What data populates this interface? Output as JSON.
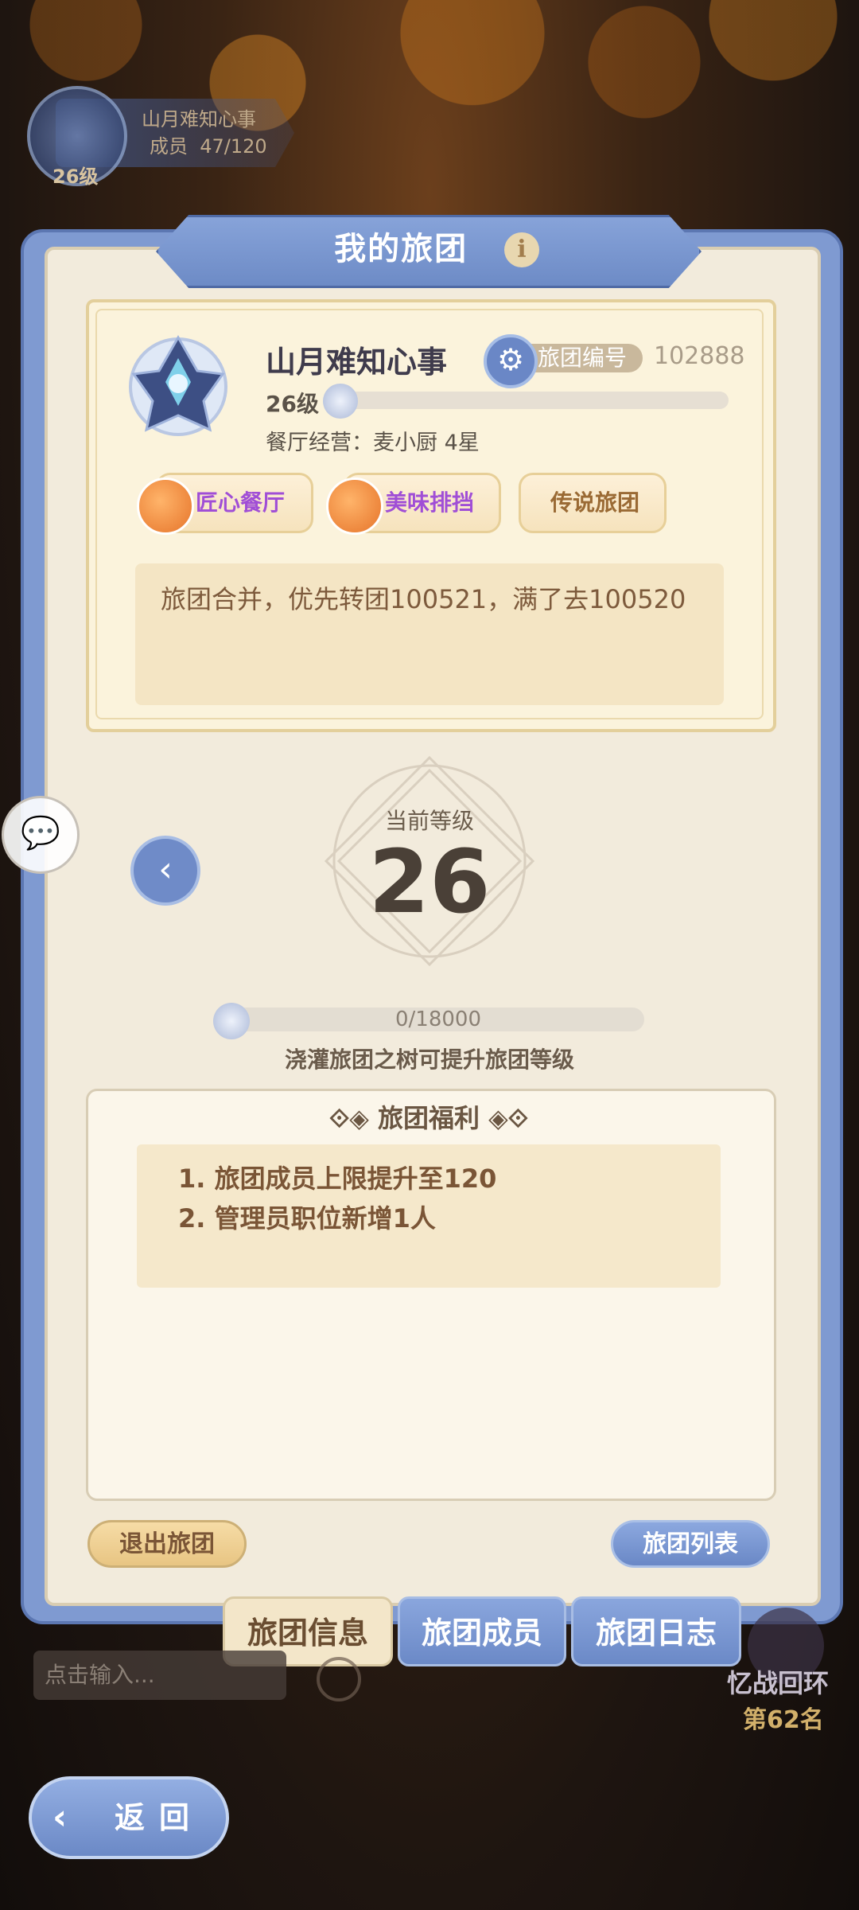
{
  "hud": {
    "guild_name": "山月难知心事",
    "members_label": "成员",
    "members_value": "47/120",
    "level": "26级"
  },
  "panel": {
    "title": "我的旅团",
    "info_icon": "i"
  },
  "guild": {
    "name": "山月难知心事",
    "id_label": "旅团编号",
    "id_value": "102888",
    "level": "26级",
    "level_progress": 0.0,
    "restaurant": "餐厅经营：麦小厨  4星",
    "tags": [
      "匠心餐厅",
      "美味排挡",
      "传说旅团"
    ],
    "notice": "旅团合并，优先转团100521，满了去100520"
  },
  "level_panel": {
    "label": "当前等级",
    "value": "26",
    "exp_text": "0/18000",
    "exp_progress": 0.0,
    "hint": "浇灌旅团之树可提升旅团等级"
  },
  "benefits": {
    "title": "旅团福利",
    "items": [
      "1.  旅团成员上限提升至120",
      "2.  管理员职位新增1人"
    ]
  },
  "actions": {
    "quit": "退出旅团",
    "list": "旅团列表"
  },
  "tabs": [
    {
      "label": "旅团信息",
      "active": true
    },
    {
      "label": "旅团成员",
      "active": false
    },
    {
      "label": "旅团日志",
      "active": false
    }
  ],
  "bottom": {
    "chat_placeholder": "点击输入...",
    "mode_name": "忆战回环",
    "mode_rank": "第62名",
    "back_label": "返回"
  },
  "colors": {
    "panel_blue": "#7f9ad1",
    "panel_cream": "#f2ebdc",
    "accent_purple": "#a04ed6",
    "text_brown": "#7a5536"
  }
}
